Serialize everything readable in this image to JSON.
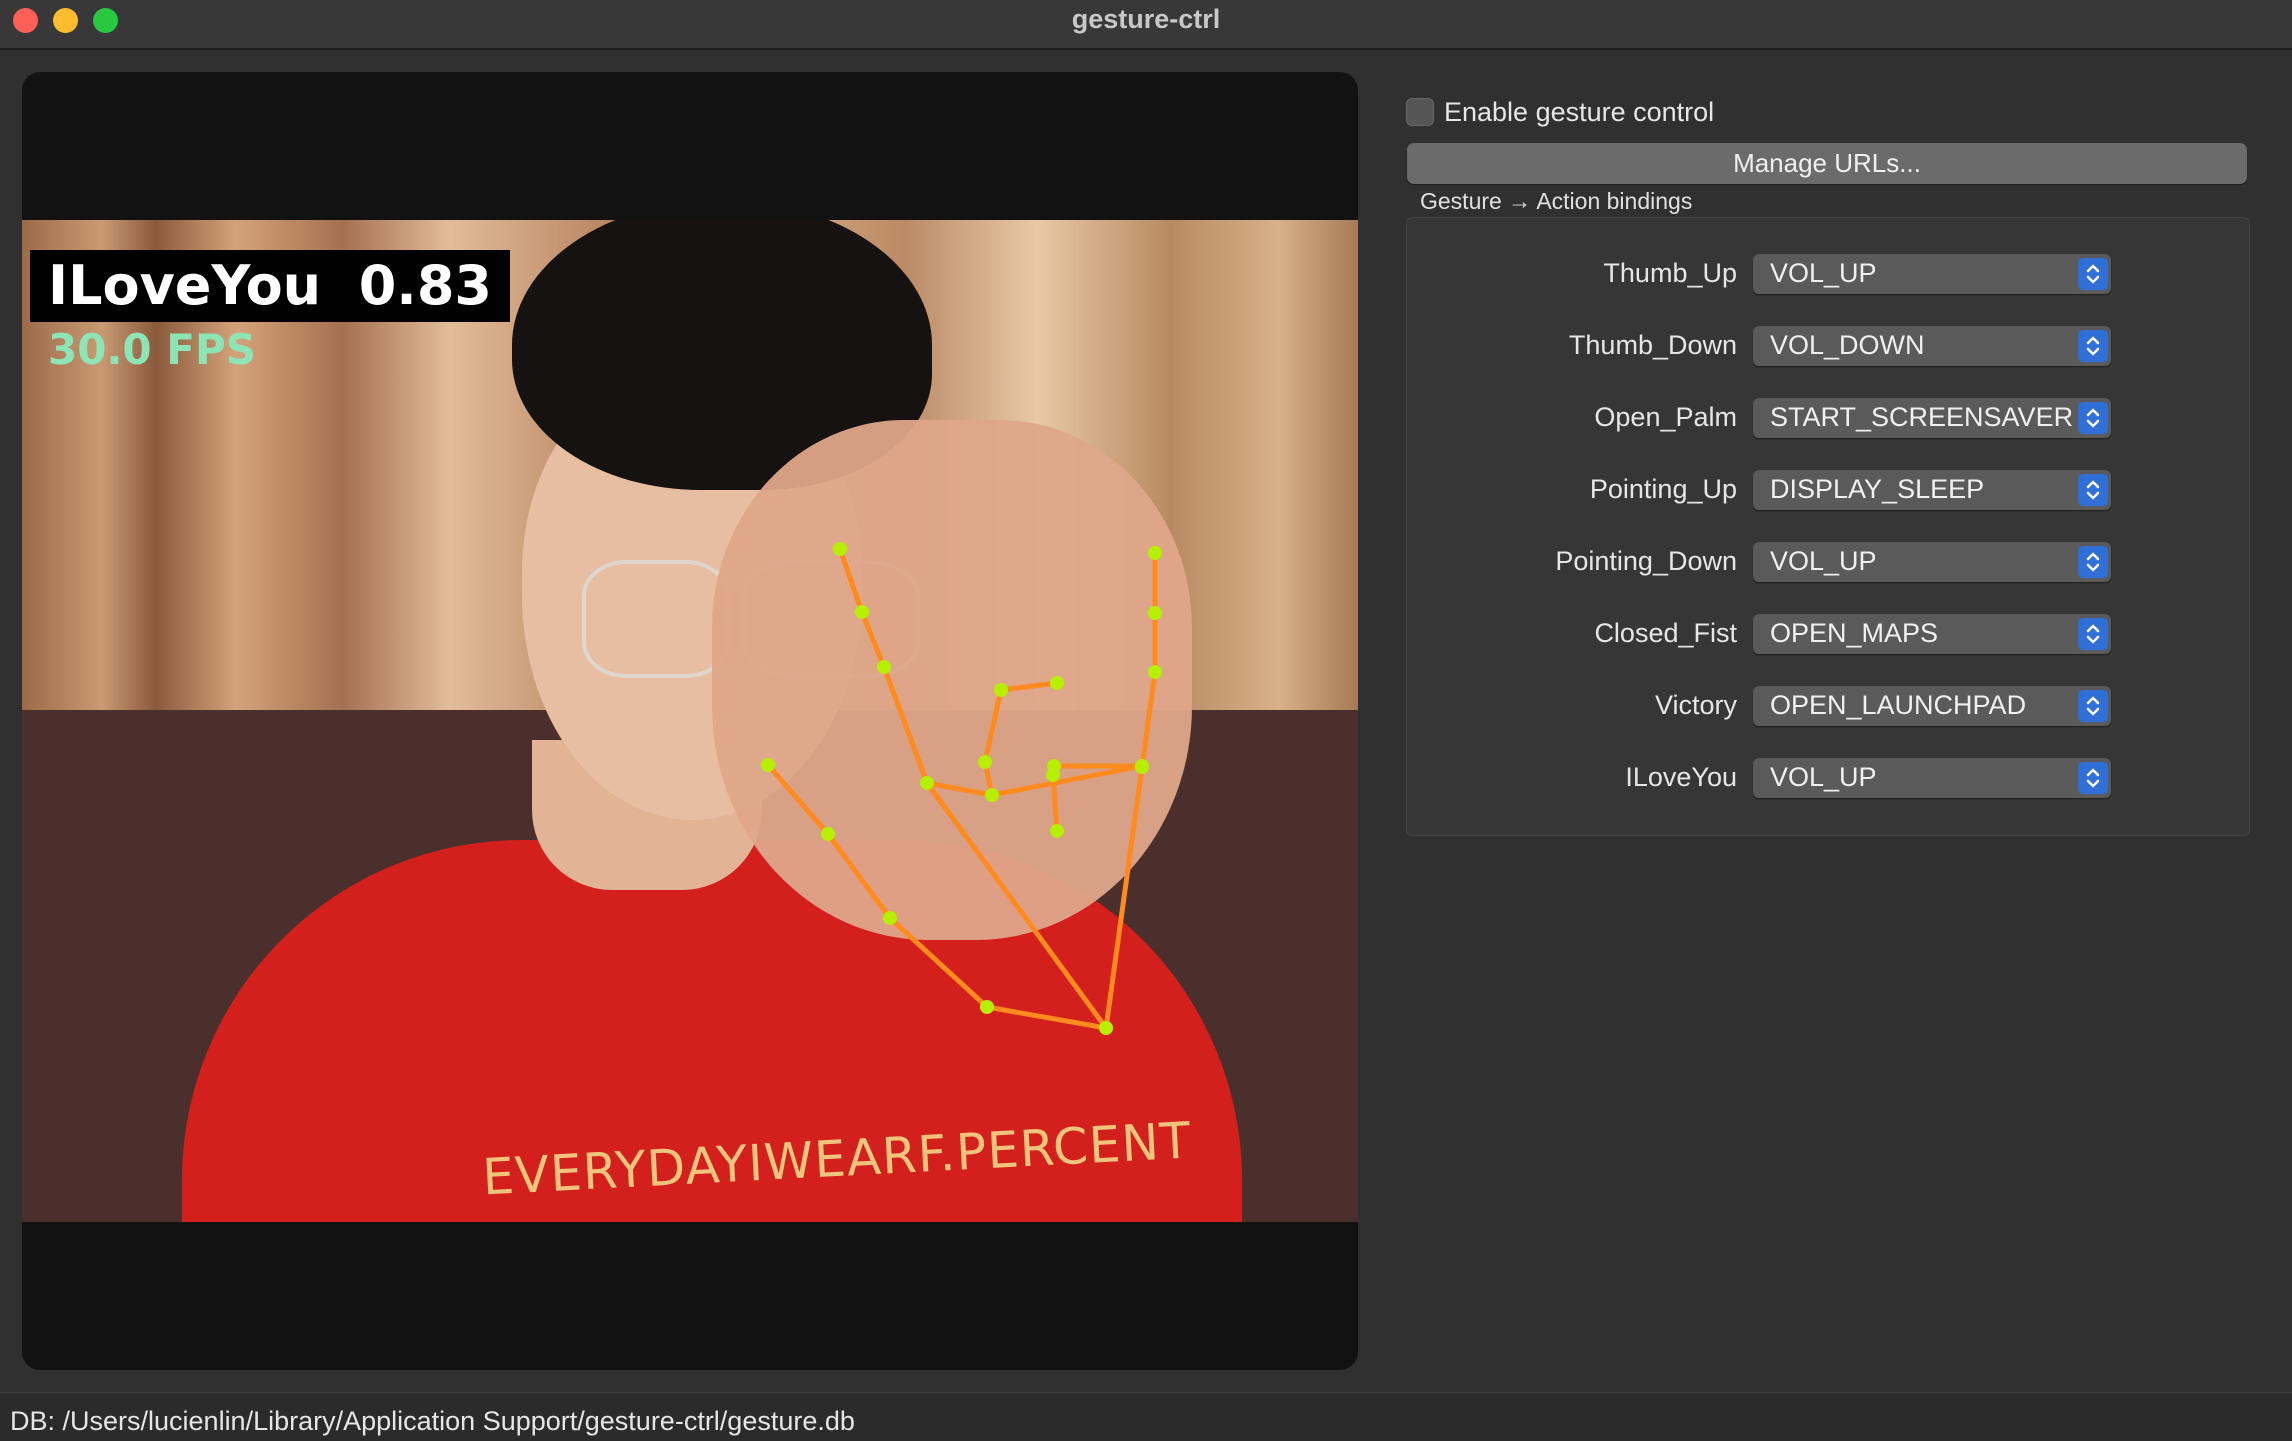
{
  "window": {
    "title": "gesture-ctrl"
  },
  "video": {
    "prediction_label": "ILoveYou",
    "prediction_score": "0.83",
    "fps_text": "30.0 FPS",
    "shirt_text": "EVERYDAYIWEARF.PERCENT",
    "landmark_color": "#ff8a1e",
    "joint_color": "#b6f000"
  },
  "controls": {
    "enable_label": "Enable gesture control",
    "enable_checked": false,
    "manage_urls_label": "Manage URLs...",
    "bindings_title": "Gesture → Action bindings",
    "bindings": [
      {
        "gesture": "Thumb_Up",
        "action": "VOL_UP"
      },
      {
        "gesture": "Thumb_Down",
        "action": "VOL_DOWN"
      },
      {
        "gesture": "Open_Palm",
        "action": "START_SCREENSAVER"
      },
      {
        "gesture": "Pointing_Up",
        "action": "DISPLAY_SLEEP"
      },
      {
        "gesture": "Pointing_Down",
        "action": "VOL_UP"
      },
      {
        "gesture": "Closed_Fist",
        "action": "OPEN_MAPS"
      },
      {
        "gesture": "Victory",
        "action": "OPEN_LAUNCHPAD"
      },
      {
        "gesture": "ILoveYou",
        "action": "VOL_UP"
      }
    ]
  },
  "status": {
    "db_path": "DB: /Users/lucienlin/Library/Application Support/gesture-ctrl/gesture.db"
  },
  "colors": {
    "accent": "#2f6fd6"
  }
}
